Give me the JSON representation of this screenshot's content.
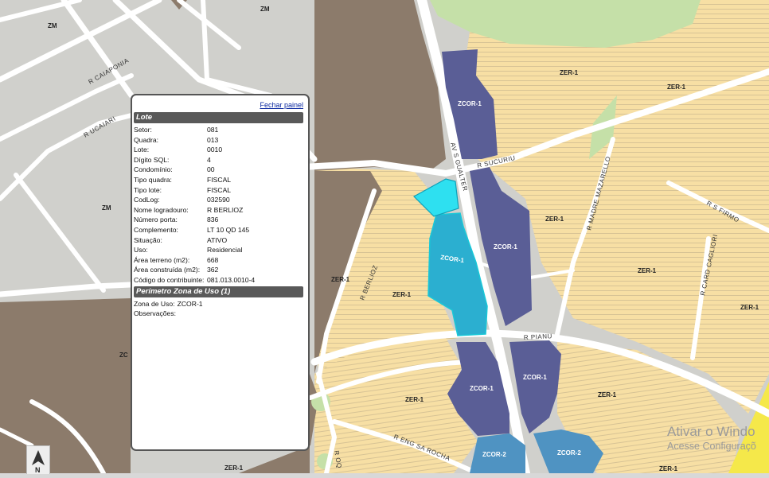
{
  "map": {
    "zone_labels": [
      {
        "name": "zm-1",
        "text": "ZM"
      },
      {
        "name": "zm-2",
        "text": "ZM"
      },
      {
        "name": "zm-3",
        "text": "ZM"
      },
      {
        "name": "zer-1",
        "text": "ZER-1"
      },
      {
        "name": "zer-2",
        "text": "ZER-1"
      },
      {
        "name": "zer-3",
        "text": "ZER-1"
      },
      {
        "name": "zer-4",
        "text": "ZER-1"
      },
      {
        "name": "zer-5",
        "text": "ZER-1"
      },
      {
        "name": "zer-6",
        "text": "ZER-1"
      },
      {
        "name": "zer-7",
        "text": "ZER-1"
      },
      {
        "name": "zer-8",
        "text": "ZER-1"
      },
      {
        "name": "zer-9",
        "text": "ZER-1"
      },
      {
        "name": "zer-10",
        "text": "ZER-1"
      },
      {
        "name": "zer-11",
        "text": "ZER-1"
      },
      {
        "name": "zcor-1",
        "text": "ZCOR-1"
      },
      {
        "name": "zcor-2",
        "text": "ZCOR-1"
      },
      {
        "name": "zcor-3",
        "text": "ZCOR-1"
      },
      {
        "name": "zcor-4",
        "text": "ZCOR-1"
      },
      {
        "name": "zcor-5",
        "text": "ZCOR-1"
      },
      {
        "name": "zcor2-1",
        "text": "ZCOR-2"
      },
      {
        "name": "zcor2-2",
        "text": "ZCOR-2"
      },
      {
        "name": "zc-partial",
        "text": "ZC"
      }
    ],
    "street_labels": [
      {
        "name": "street-caiaponia",
        "text": "R CAIAPONIA"
      },
      {
        "name": "street-ucaiari",
        "text": "R UCAIARI"
      },
      {
        "name": "street-sucuriu",
        "text": "R SUCURIU"
      },
      {
        "name": "street-gualter",
        "text": "AV S GUALTER"
      },
      {
        "name": "street-mazarello",
        "text": "R MADRE MAZARELLO"
      },
      {
        "name": "street-firmo",
        "text": "R S FIRMO"
      },
      {
        "name": "street-cagliori",
        "text": "R CARD CAGLIORI"
      },
      {
        "name": "street-berlioz",
        "text": "R BERLIOZ"
      },
      {
        "name": "street-pianu",
        "text": "R PIANU"
      },
      {
        "name": "street-sa-rocha",
        "text": "R ENG SA ROCHA"
      },
      {
        "name": "street-oq",
        "text": "R OQ"
      }
    ],
    "colors": {
      "zm": "#d0d0cc",
      "zer": "#f7dfa4",
      "zcor1": "#5a5e96",
      "zcor2": "#4f93c2",
      "selected": "#2bafd0",
      "selected_top": "#2ee0f0",
      "green": "#c5e0a8",
      "brown": "#8c7b6b",
      "road": "#ffffff"
    }
  },
  "panel": {
    "close_label": "Fechar painel",
    "lote_header": "Lote",
    "lote_rows": [
      {
        "k": "Setor:",
        "v": "081"
      },
      {
        "k": "Quadra:",
        "v": "013"
      },
      {
        "k": "Lote:",
        "v": "0010"
      },
      {
        "k": "Dígito SQL:",
        "v": "4"
      },
      {
        "k": "Condomínio:",
        "v": "00"
      },
      {
        "k": "Tipo quadra:",
        "v": "FISCAL"
      },
      {
        "k": "Tipo lote:",
        "v": "FISCAL"
      },
      {
        "k": "CodLog:",
        "v": "032590"
      },
      {
        "k": "Nome logradouro:",
        "v": "R BERLIOZ"
      },
      {
        "k": "Número porta:",
        "v": "836"
      },
      {
        "k": "Complemento:",
        "v": "LT 10 QD 145"
      },
      {
        "k": "Situação:",
        "v": "ATIVO"
      },
      {
        "k": "Uso:",
        "v": "Residencial"
      },
      {
        "k": "Área terreno (m2):",
        "v": "668"
      },
      {
        "k": "Área construída (m2):",
        "v": "362"
      },
      {
        "k": "Código do contribuinte:",
        "v": "081.013.0010-4"
      }
    ],
    "perimetro_header": "Perímetro Zona de Uso (1)",
    "zona_rows": [
      {
        "k": "Zona de Uso:",
        "v": "ZCOR-1"
      },
      {
        "k": "Observações:",
        "v": ""
      }
    ]
  },
  "compass": {
    "letter": "N"
  },
  "watermark": {
    "line1": "Ativar o Windo",
    "line2": "Acesse Configuraçõ"
  }
}
